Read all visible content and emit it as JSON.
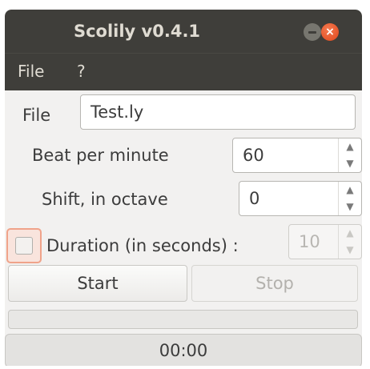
{
  "window": {
    "title": "Scolily v0.4.1",
    "close_glyph": "×"
  },
  "menubar": {
    "items": [
      {
        "label": "File"
      },
      {
        "label": "?"
      }
    ]
  },
  "form": {
    "file": {
      "label": "File",
      "value": "Test.ly"
    },
    "bpm": {
      "label": "Beat per minute",
      "value": "60"
    },
    "shift": {
      "label": "Shift, in octave",
      "value": "0"
    },
    "duration": {
      "label": "Duration (in seconds) :",
      "value": "10",
      "checked": false,
      "enabled": false
    }
  },
  "buttons": {
    "start_label": "Start",
    "stop_label": "Stop"
  },
  "progress": {
    "value": 0
  },
  "status": {
    "time": "00:00"
  },
  "icons": {
    "spin_up": "▲",
    "spin_down": "▼"
  }
}
